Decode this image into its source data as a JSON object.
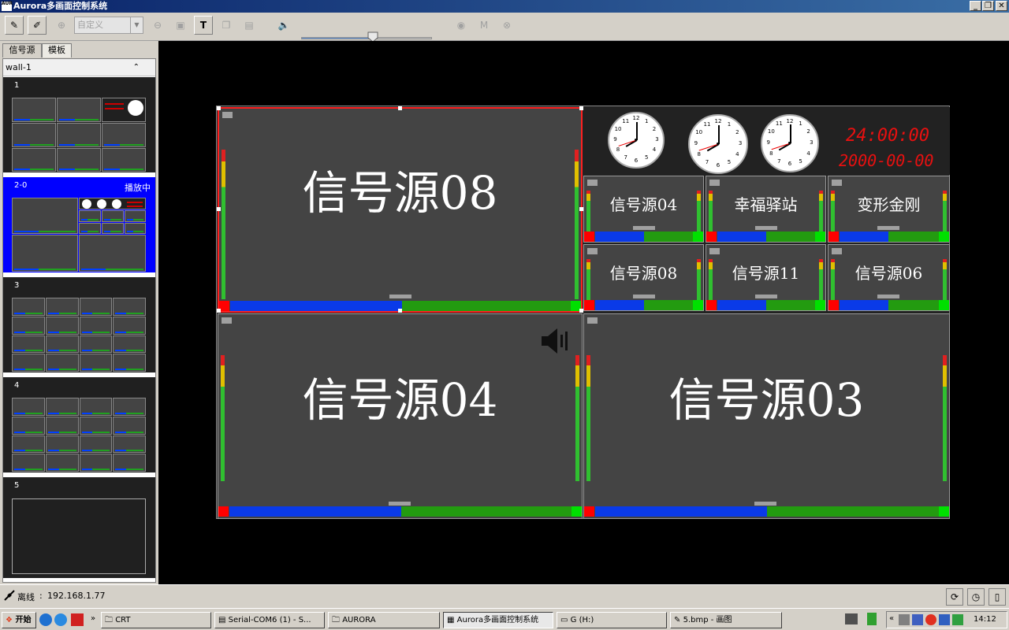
{
  "window": {
    "title": "Aurora多画面控制系统",
    "app_icon_text": "AUR",
    "controls": [
      "_",
      "❐",
      "✕"
    ]
  },
  "toolbar": {
    "buttons": [
      {
        "name": "connect",
        "glyph": "✎"
      },
      {
        "name": "disconnect",
        "glyph": "✐"
      },
      {
        "name": "zoom-in",
        "glyph": "⊕"
      },
      {
        "name": "zoom-out",
        "glyph": "⊖"
      },
      {
        "name": "fit",
        "glyph": "▣"
      },
      {
        "name": "text",
        "glyph": "T"
      },
      {
        "name": "copy",
        "glyph": "❐"
      },
      {
        "name": "image",
        "glyph": "▤"
      },
      {
        "name": "sound",
        "glyph": "🔈"
      },
      {
        "name": "record",
        "glyph": "◉"
      },
      {
        "name": "mode",
        "glyph": "M"
      },
      {
        "name": "link",
        "glyph": "⊗"
      }
    ],
    "preset_value": "自定义",
    "volume_percent": 55
  },
  "sidebar": {
    "tabs": [
      "信号源",
      "模板"
    ],
    "active_tab": "模板",
    "wall_name": "wall-1",
    "templates": [
      {
        "num": "1",
        "status": ""
      },
      {
        "num": "2-0",
        "status": "播放中"
      },
      {
        "num": "3",
        "status": ""
      },
      {
        "num": "4",
        "status": ""
      },
      {
        "num": "5",
        "status": ""
      }
    ]
  },
  "wall": {
    "windows": [
      {
        "title": "信号源08",
        "size": "large"
      },
      {
        "title": "信号源04",
        "size": "large"
      },
      {
        "title": "信号源03",
        "size": "large"
      },
      {
        "title": "信号源04",
        "size": "small"
      },
      {
        "title": "幸福驿站",
        "size": "small"
      },
      {
        "title": "变形金刚",
        "size": "small"
      },
      {
        "title": "信号源08",
        "size": "small"
      },
      {
        "title": "信号源11",
        "size": "small"
      },
      {
        "title": "信号源06",
        "size": "small"
      }
    ],
    "digital_time": "24:00:00",
    "digital_date": "2000-00-00",
    "clocks": [
      {
        "hour": 8,
        "minute": 0,
        "second": 42
      },
      {
        "hour": 8,
        "minute": 0,
        "second": 42
      },
      {
        "hour": 8,
        "minute": 0,
        "second": 42
      }
    ]
  },
  "statusbar": {
    "state": "离线",
    "separator": ":",
    "ip": "192.168.1.77"
  },
  "taskbar": {
    "start": "开始",
    "items": [
      {
        "label": "CRT"
      },
      {
        "label": "Serial-COM6 (1) - S..."
      },
      {
        "label": "AURORA"
      },
      {
        "label": "Aurora多画面控制系统"
      },
      {
        "label": "G (H:)"
      },
      {
        "label": "5.bmp - 画图"
      }
    ],
    "time": "14:12"
  },
  "colors": {
    "title_bar": "#0a246a",
    "selected_template": "#0000ff",
    "window_bg": "#444444",
    "bar_blue": "#0a3ae8",
    "bar_green": "#239b10",
    "digital_red": "#e81010"
  }
}
